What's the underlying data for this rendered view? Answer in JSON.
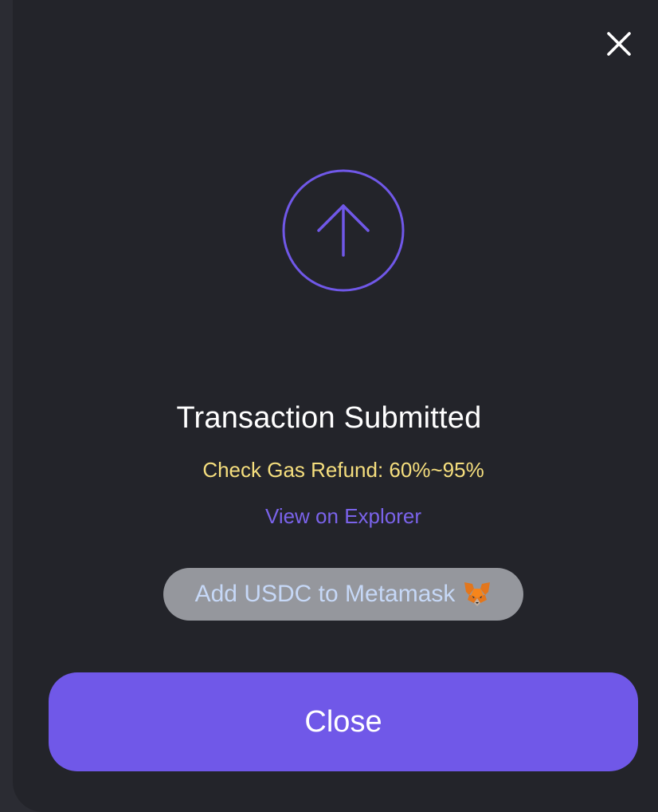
{
  "modal": {
    "title": "Transaction Submitted",
    "gas_refund_text": "Check Gas Refund: 60%~95%",
    "explorer_link": "View on Explorer",
    "add_token_button": "Add USDC to Metamask",
    "close_button": "Close"
  },
  "icons": {
    "close": "close-icon",
    "status": "arrow-up-circle-icon",
    "wallet": "metamask-fox-icon"
  },
  "colors": {
    "accent": "#7058e8",
    "warning_text": "#f6df7e",
    "link": "#7a63ea",
    "modal_bg": "#23242a"
  }
}
